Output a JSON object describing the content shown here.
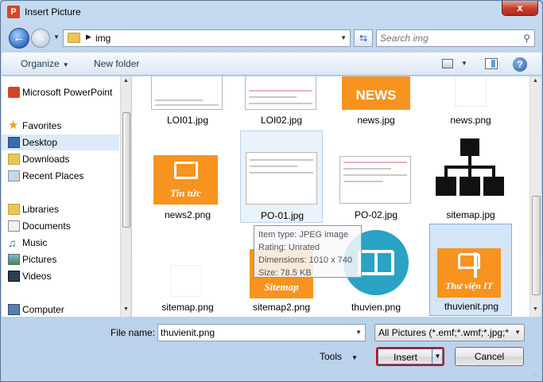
{
  "window": {
    "title": "Insert Picture",
    "close_label": "x"
  },
  "nav": {
    "path": "img",
    "search_placeholder": "Search img"
  },
  "toolbar": {
    "organize": "Organize",
    "new_folder": "New folder",
    "help": "?"
  },
  "sidebar": {
    "items": [
      {
        "label": "Microsoft PowerPoint",
        "icon": "powerpoint-icon"
      },
      {
        "label": "Favorites",
        "icon": "star-icon"
      },
      {
        "label": "Desktop",
        "icon": "desktop-icon"
      },
      {
        "label": "Downloads",
        "icon": "downloads-icon"
      },
      {
        "label": "Recent Places",
        "icon": "recent-places-icon"
      },
      {
        "label": "Libraries",
        "icon": "libraries-icon"
      },
      {
        "label": "Documents",
        "icon": "documents-icon"
      },
      {
        "label": "Music",
        "icon": "music-icon"
      },
      {
        "label": "Pictures",
        "icon": "pictures-icon"
      },
      {
        "label": "Videos",
        "icon": "videos-icon"
      },
      {
        "label": "Computer",
        "icon": "computer-icon"
      }
    ]
  },
  "files": [
    {
      "name": "LOI01.jpg"
    },
    {
      "name": "LOI02.jpg"
    },
    {
      "name": "news.jpg",
      "logo_text": "NEWS"
    },
    {
      "name": "news.png"
    },
    {
      "name": "news2.png",
      "logo_text": "Tin tức"
    },
    {
      "name": "PO-01.jpg"
    },
    {
      "name": "PO-02.jpg"
    },
    {
      "name": "sitemap.jpg"
    },
    {
      "name": "sitemap.png"
    },
    {
      "name": "sitemap2.png",
      "logo_text": "Sitemap"
    },
    {
      "name": "thuvien.png"
    },
    {
      "name": "thuvienit.png",
      "logo_text": "Thư viện IT"
    }
  ],
  "tooltip": {
    "type": "Item type: JPEG image",
    "rating": "Rating: Unrated",
    "dimensions": "Dimensions: 1010 x 740",
    "size": "Size: 78.5 KB"
  },
  "bottom": {
    "file_name_label": "File name:",
    "file_name_value": "thuvienit.png",
    "filter": "All Pictures (*.emf;*.wmf;*.jpg;*",
    "tools": "Tools",
    "insert": "Insert",
    "cancel": "Cancel"
  },
  "colors": {
    "accent_orange": "#f7931e",
    "selection": "#d5e5f8",
    "insert_highlight": "#d40000"
  }
}
